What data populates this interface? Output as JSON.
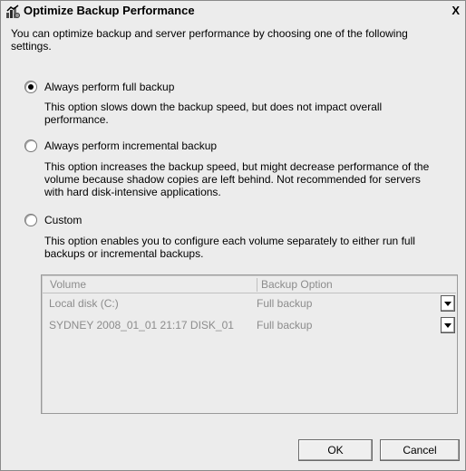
{
  "window": {
    "title": "Optimize Backup Performance",
    "close_label": "X"
  },
  "intro": {
    "line1": "You can optimize backup and server performance by choosing one of the following",
    "line2": "settings."
  },
  "options": {
    "full": {
      "label": "Always perform full backup",
      "selected": true,
      "desc1": "This option slows down the backup speed, but does not impact overall",
      "desc2": "performance."
    },
    "incremental": {
      "label": "Always perform incremental backup",
      "selected": false,
      "desc1": "This option increases the backup speed, but might decrease performance of the",
      "desc2": "volume because shadow copies are left behind. Not recommended for servers",
      "desc3": "with hard disk-intensive applications."
    },
    "custom": {
      "label": "Custom",
      "selected": false,
      "desc1": "This option enables you to configure each volume separately to either run full",
      "desc2": "backups or incremental backups."
    }
  },
  "table": {
    "headers": [
      "Volume",
      "Backup Option"
    ],
    "rows": [
      {
        "volume": "Local disk (C:)",
        "option": "Full backup"
      },
      {
        "volume": "SYDNEY 2008_01_01 21:17 DISK_01",
        "option": "Full backup"
      }
    ]
  },
  "buttons": {
    "ok": "OK",
    "cancel": "Cancel"
  }
}
